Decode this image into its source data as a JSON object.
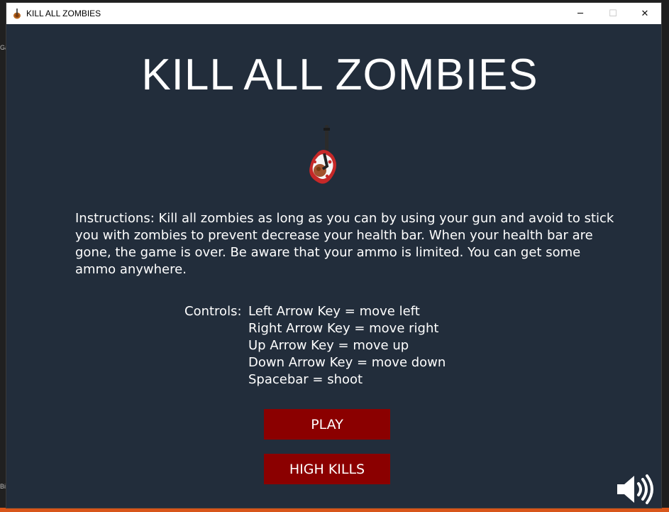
{
  "window": {
    "title": "KILL ALL ZOMBIES",
    "controls": {
      "minimize": "─",
      "maximize": "☐",
      "close": "✕"
    }
  },
  "desktop": {
    "left_ticks": [
      "Ga",
      "Bi"
    ]
  },
  "game": {
    "title": "KILL ALL ZOMBIES",
    "logo_icon": "zombie-with-gun-icon",
    "instructions": "Instructions: Kill all zombies as long as you can by using your gun and avoid to stick you with zombies to prevent decrease your health bar. When your health bar are gone, the game is over. Be aware that your ammo is limited. You can get some ammo anywhere.",
    "controls_label": "Controls:",
    "controls": [
      "Left Arrow Key = move left",
      "Right Arrow Key = move right",
      "Up Arrow Key = move up",
      "Down Arrow Key = move down",
      "Spacebar = shoot"
    ],
    "buttons": {
      "play": "PLAY",
      "high_kills": "HIGH KILLS"
    },
    "sound_icon": "speaker-volume-icon"
  },
  "colors": {
    "background": "#222d3b",
    "button": "#8b0000",
    "text": "#ffffff",
    "taskbar_accent": "#d8561a"
  }
}
